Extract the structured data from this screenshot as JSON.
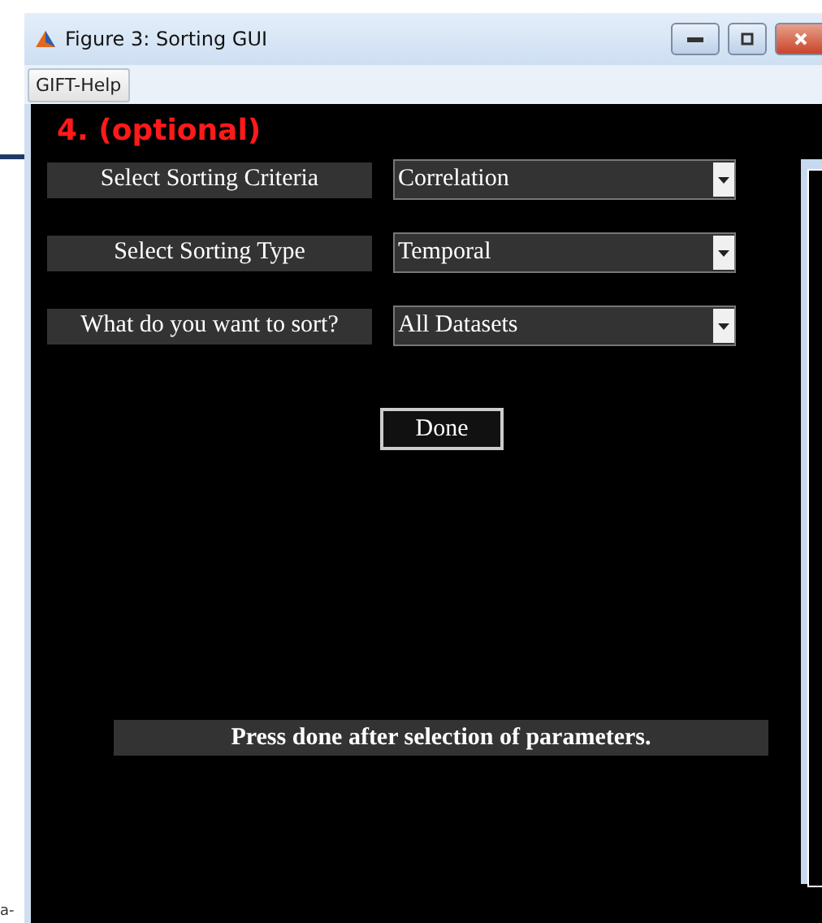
{
  "window": {
    "title": "Figure 3: Sorting GUI"
  },
  "menu": [
    "GIFT-Help"
  ],
  "heading": "4. (optional)",
  "fields": [
    {
      "label": "Select Sorting Criteria",
      "value": "Correlation"
    },
    {
      "label": "Select Sorting Type",
      "value": "Temporal"
    },
    {
      "label": "What do you want to sort?",
      "value": "All Datasets"
    }
  ],
  "done_button": "Done",
  "message": "Press done after selection of parameters.",
  "edge_text": "a-"
}
